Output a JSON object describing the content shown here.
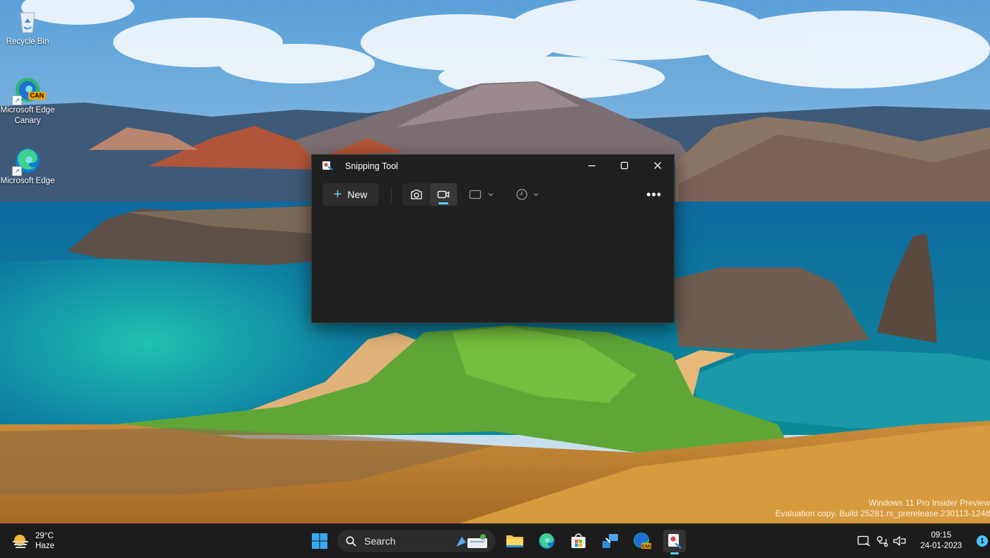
{
  "desktop": {
    "icons": [
      {
        "label": "Recycle Bin"
      },
      {
        "label": "Microsoft Edge Canary",
        "badge": "CAN"
      },
      {
        "label": "Microsoft Edge"
      }
    ],
    "watermark": {
      "line1": "Windows 11 Pro Insider Preview",
      "line2": "Evaluation copy. Build 25281.rs_prerelease.230113-1248"
    }
  },
  "snipping_tool": {
    "title": "Snipping Tool",
    "new_label": "New",
    "active_mode": "video",
    "accent": "#60cdff"
  },
  "taskbar": {
    "weather": {
      "temp": "29°C",
      "condition": "Haze"
    },
    "search_label": "Search",
    "edge_canary_badge": "CAN",
    "clock": {
      "time": "09:15",
      "date": "24-01-2023"
    },
    "notifications": "1"
  }
}
